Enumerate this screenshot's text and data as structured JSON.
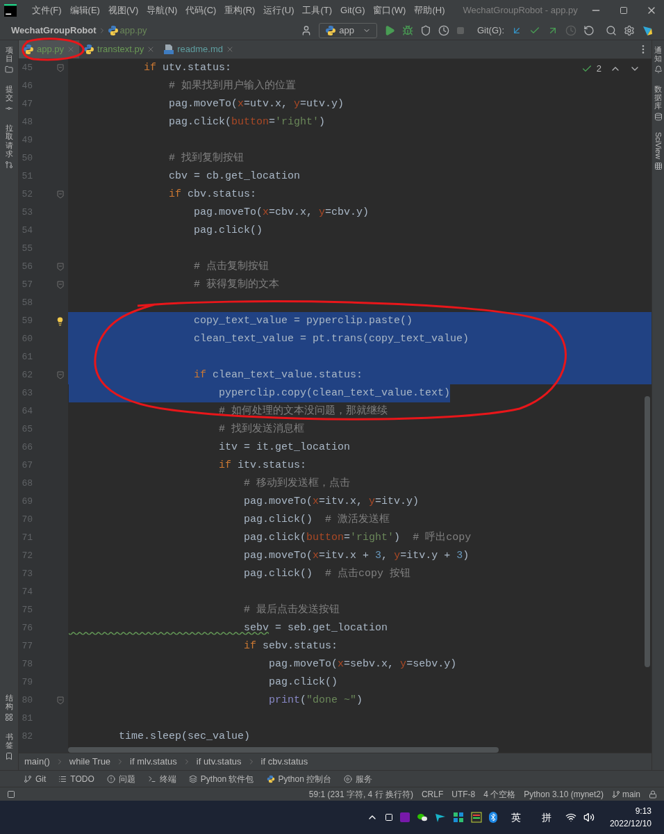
{
  "title_bar": {
    "menus": [
      "文件(F)",
      "编辑(E)",
      "视图(V)",
      "导航(N)",
      "代码(C)",
      "重构(R)",
      "运行(U)",
      "工具(T)",
      "Git(G)",
      "窗口(W)",
      "帮助(H)"
    ],
    "title": "WechatGroupRobot - app.py"
  },
  "nav_bar": {
    "project": "WechatGroupRobot",
    "file": "app.py",
    "run_config": "app",
    "git_label": "Git(G):"
  },
  "left_strip": {
    "top": [
      {
        "label": "项目",
        "kind": "folder"
      },
      {
        "label": "提交",
        "kind": "commit"
      },
      {
        "label": "拉取请求",
        "kind": "pull"
      }
    ],
    "bottom": [
      {
        "label": "结构",
        "kind": "structure"
      },
      {
        "label": "书签",
        "kind": "bookmark"
      }
    ]
  },
  "right_strip": [
    {
      "label": "通知",
      "kind": "bell"
    },
    {
      "label": "数据库",
      "kind": "database"
    },
    {
      "label": "SciView",
      "kind": "grid"
    }
  ],
  "tabs": [
    {
      "label": "app.py",
      "kind": "python",
      "selected": true
    },
    {
      "label": "transtext.py",
      "kind": "python",
      "selected": false
    },
    {
      "label": "readme.md",
      "kind": "markdown",
      "selected": false
    }
  ],
  "inspections": {
    "count": "2"
  },
  "editor": {
    "lines": [
      {
        "number": "45",
        "fold": true,
        "bulb": false,
        "selected": false,
        "tokens": [
          {
            "kind": "keyword",
            "text": "            if"
          },
          {
            "kind": "plain",
            "text": " utv.status:"
          }
        ]
      },
      {
        "number": "46",
        "fold": false,
        "bulb": false,
        "selected": false,
        "tokens": [
          {
            "kind": "comment",
            "text": "                # 如果找到用户输入的位置"
          }
        ]
      },
      {
        "number": "47",
        "fold": false,
        "bulb": false,
        "selected": false,
        "tokens": [
          {
            "kind": "plain",
            "text": "                pag.moveTo("
          },
          {
            "kind": "param",
            "text": "x"
          },
          {
            "kind": "plain",
            "text": "=utv.x, "
          },
          {
            "kind": "param",
            "text": "y"
          },
          {
            "kind": "plain",
            "text": "=utv.y)"
          }
        ]
      },
      {
        "number": "48",
        "fold": false,
        "bulb": false,
        "selected": false,
        "tokens": [
          {
            "kind": "plain",
            "text": "                pag.click("
          },
          {
            "kind": "param",
            "text": "button"
          },
          {
            "kind": "plain",
            "text": "="
          },
          {
            "kind": "string",
            "text": "'right'"
          },
          {
            "kind": "plain",
            "text": ")"
          }
        ]
      },
      {
        "number": "49",
        "fold": false,
        "bulb": false,
        "selected": false
      },
      {
        "number": "50",
        "fold": false,
        "bulb": false,
        "selected": false,
        "tokens": [
          {
            "kind": "comment",
            "text": "                # 找到复制按钮"
          }
        ]
      },
      {
        "number": "51",
        "fold": false,
        "bulb": false,
        "selected": false,
        "tokens": [
          {
            "kind": "plain",
            "text": "                cbv = cb.get_location"
          }
        ]
      },
      {
        "number": "52",
        "fold": true,
        "bulb": false,
        "selected": false,
        "tokens": [
          {
            "kind": "keyword",
            "text": "                if"
          },
          {
            "kind": "plain",
            "text": " cbv.status:"
          }
        ]
      },
      {
        "number": "53",
        "fold": false,
        "bulb": false,
        "selected": false,
        "tokens": [
          {
            "kind": "plain",
            "text": "                    pag.moveTo("
          },
          {
            "kind": "param",
            "text": "x"
          },
          {
            "kind": "plain",
            "text": "=cbv.x, "
          },
          {
            "kind": "param",
            "text": "y"
          },
          {
            "kind": "plain",
            "text": "=cbv.y)"
          }
        ]
      },
      {
        "number": "54",
        "fold": false,
        "bulb": false,
        "selected": false,
        "tokens": [
          {
            "kind": "plain",
            "text": "                    pag.click()"
          }
        ]
      },
      {
        "number": "55",
        "fold": false,
        "bulb": false,
        "selected": false
      },
      {
        "number": "56",
        "fold": true,
        "bulb": false,
        "selected": false,
        "tokens": [
          {
            "kind": "comment",
            "text": "                    # 点击复制按钮"
          }
        ]
      },
      {
        "number": "57",
        "fold": true,
        "bulb": false,
        "selected": false,
        "tokens": [
          {
            "kind": "comment",
            "text": "                    # 获得复制的文本"
          }
        ]
      },
      {
        "number": "58",
        "fold": false,
        "bulb": false,
        "selected": false
      },
      {
        "number": "59",
        "fold": false,
        "bulb": true,
        "selected": true,
        "tokens": [
          {
            "kind": "plain",
            "text": "                    copy_text_value = pyperclip.paste()"
          }
        ]
      },
      {
        "number": "60",
        "fold": false,
        "bulb": false,
        "selected": true,
        "tokens": [
          {
            "kind": "plain",
            "text": "                    clean_text_value = pt.trans(copy_text_value)"
          }
        ]
      },
      {
        "number": "61",
        "fold": false,
        "bulb": false,
        "selected": true
      },
      {
        "number": "62",
        "fold": true,
        "bulb": false,
        "selected": true,
        "tokens": [
          {
            "kind": "keyword",
            "text": "                    if"
          },
          {
            "kind": "plain",
            "text": " clean_text_value.status:"
          }
        ]
      },
      {
        "number": "63",
        "fold": false,
        "bulb": false,
        "selected": true,
        "tokens": [
          {
            "kind": "plain",
            "text": "                        pyperclip.copy(clean_text_value.text)"
          }
        ]
      },
      {
        "number": "64",
        "fold": false,
        "bulb": false,
        "selected": false,
        "tokens": [
          {
            "kind": "comment",
            "text": "                        # 如何处理的文本没问题，那就继续"
          }
        ]
      },
      {
        "number": "65",
        "fold": false,
        "bulb": false,
        "selected": false,
        "tokens": [
          {
            "kind": "comment",
            "text": "                        # 找到发送消息框"
          }
        ]
      },
      {
        "number": "66",
        "fold": false,
        "bulb": false,
        "selected": false,
        "tokens": [
          {
            "kind": "plain",
            "text": "                        itv = it.get_location"
          }
        ]
      },
      {
        "number": "67",
        "fold": false,
        "bulb": false,
        "selected": false,
        "tokens": [
          {
            "kind": "keyword",
            "text": "                        if"
          },
          {
            "kind": "plain",
            "text": " itv.status:"
          }
        ]
      },
      {
        "number": "68",
        "fold": false,
        "bulb": false,
        "selected": false,
        "tokens": [
          {
            "kind": "comment",
            "text": "                            # 移动到发送框，点击"
          }
        ]
      },
      {
        "number": "69",
        "fold": false,
        "bulb": false,
        "selected": false,
        "tokens": [
          {
            "kind": "plain",
            "text": "                            pag.moveTo("
          },
          {
            "kind": "param",
            "text": "x"
          },
          {
            "kind": "plain",
            "text": "=itv.x, "
          },
          {
            "kind": "param",
            "text": "y"
          },
          {
            "kind": "plain",
            "text": "=itv.y)"
          }
        ]
      },
      {
        "number": "70",
        "fold": false,
        "bulb": false,
        "selected": false,
        "tokens": [
          {
            "kind": "plain",
            "text": "                            pag.click()  "
          },
          {
            "kind": "comment",
            "text": "# 激活发送框"
          }
        ]
      },
      {
        "number": "71",
        "fold": false,
        "bulb": false,
        "selected": false,
        "tokens": [
          {
            "kind": "plain",
            "text": "                            pag.click("
          },
          {
            "kind": "param",
            "text": "button"
          },
          {
            "kind": "plain",
            "text": "="
          },
          {
            "kind": "string",
            "text": "'right'"
          },
          {
            "kind": "plain",
            "text": ")  "
          },
          {
            "kind": "comment",
            "text": "# 呼出copy"
          }
        ]
      },
      {
        "number": "72",
        "fold": false,
        "bulb": false,
        "selected": false,
        "tokens": [
          {
            "kind": "plain",
            "text": "                            pag.moveTo("
          },
          {
            "kind": "param",
            "text": "x"
          },
          {
            "kind": "plain",
            "text": "=itv.x + "
          },
          {
            "kind": "number",
            "text": "3"
          },
          {
            "kind": "plain",
            "text": ", "
          },
          {
            "kind": "param",
            "text": "y"
          },
          {
            "kind": "plain",
            "text": "=itv.y + "
          },
          {
            "kind": "number",
            "text": "3"
          },
          {
            "kind": "plain",
            "text": ")"
          }
        ]
      },
      {
        "number": "73",
        "fold": false,
        "bulb": false,
        "selected": false,
        "tokens": [
          {
            "kind": "plain",
            "text": "                            pag.click()  "
          },
          {
            "kind": "comment",
            "text": "# 点击copy 按钮"
          }
        ]
      },
      {
        "number": "74",
        "fold": false,
        "bulb": false,
        "selected": false
      },
      {
        "number": "75",
        "fold": false,
        "bulb": false,
        "selected": false,
        "tokens": [
          {
            "kind": "comment",
            "text": "                            # 最后点击发送按钮"
          }
        ]
      },
      {
        "number": "76",
        "fold": false,
        "bulb": false,
        "selected": false,
        "tokens": [
          {
            "kind": "warning",
            "text": "                            sebv"
          },
          {
            "kind": "plain",
            "text": " = seb.get_location"
          }
        ]
      },
      {
        "number": "77",
        "fold": false,
        "bulb": false,
        "selected": false,
        "tokens": [
          {
            "kind": "keyword",
            "text": "                            if"
          },
          {
            "kind": "plain",
            "text": " sebv.status:"
          }
        ]
      },
      {
        "number": "78",
        "fold": false,
        "bulb": false,
        "selected": false,
        "tokens": [
          {
            "kind": "plain",
            "text": "                                pag.moveTo("
          },
          {
            "kind": "param",
            "text": "x"
          },
          {
            "kind": "plain",
            "text": "=sebv.x, "
          },
          {
            "kind": "param",
            "text": "y"
          },
          {
            "kind": "plain",
            "text": "=sebv.y)"
          }
        ]
      },
      {
        "number": "79",
        "fold": false,
        "bulb": false,
        "selected": false,
        "tokens": [
          {
            "kind": "plain",
            "text": "                                pag.click()"
          }
        ]
      },
      {
        "number": "80",
        "fold": true,
        "bulb": false,
        "selected": false,
        "tokens": [
          {
            "kind": "builtin",
            "text": "                                print"
          },
          {
            "kind": "plain",
            "text": "("
          },
          {
            "kind": "string",
            "text": "\"done ~\""
          },
          {
            "kind": "plain",
            "text": ")"
          }
        ]
      },
      {
        "number": "81",
        "fold": false,
        "bulb": false,
        "selected": false
      },
      {
        "number": "82",
        "fold": false,
        "bulb": false,
        "selected": false,
        "tokens": [
          {
            "kind": "plain",
            "text": "        time.sleep(sec_value)"
          }
        ]
      }
    ]
  },
  "breadcrumbs": [
    "main()",
    "while True",
    "if mlv.status",
    "if utv.status",
    "if cbv.status"
  ],
  "tool_windows": [
    {
      "label": "Git",
      "kind": "git"
    },
    {
      "label": "TODO",
      "kind": "list"
    },
    {
      "label": "问题",
      "kind": "problem"
    },
    {
      "label": "终端",
      "kind": "terminal"
    },
    {
      "label": "Python 软件包",
      "kind": "layers"
    },
    {
      "label": "Python 控制台",
      "kind": "python"
    },
    {
      "label": "服务",
      "kind": "play"
    }
  ],
  "status_bar": {
    "items": [
      "59:1 (231 字符, 4 行 换行符)",
      "CRLF",
      "UTF-8",
      "4 个空格",
      "Python 3.10 (mynet2)"
    ],
    "branch": "main"
  },
  "taskbar": {
    "ime": [
      "英",
      "拼"
    ],
    "time": "9:13",
    "date": "2022/12/10"
  }
}
